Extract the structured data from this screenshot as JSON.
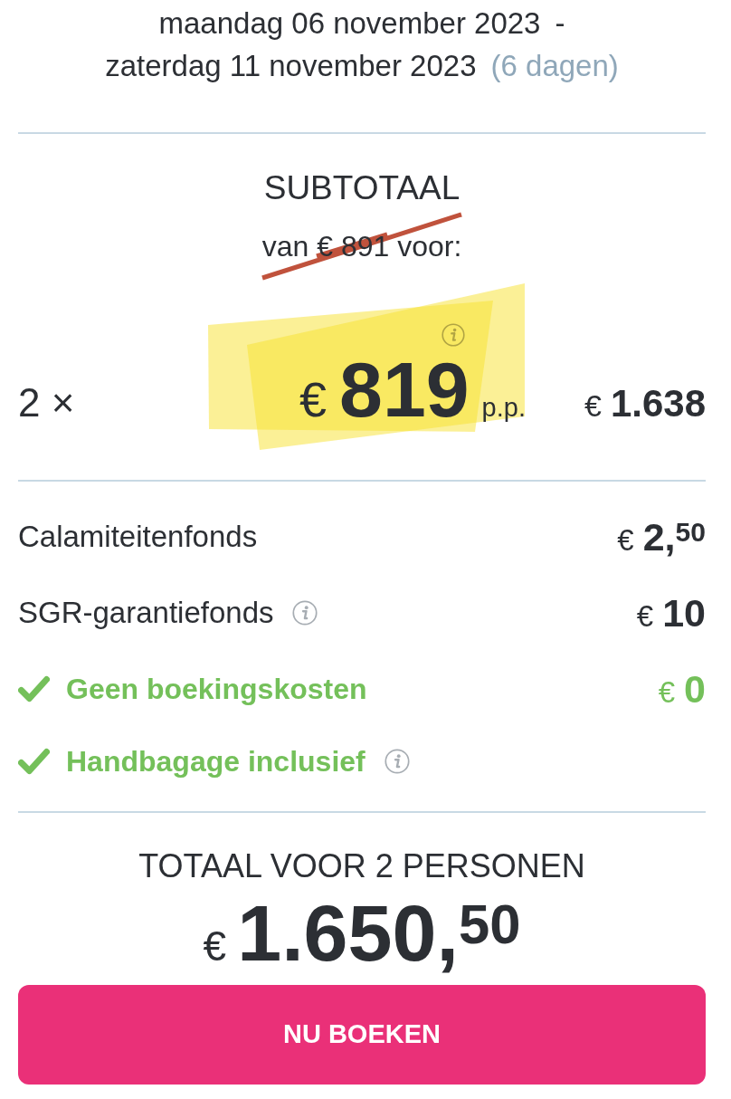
{
  "period": {
    "start_date": "maandag 06 november 2023",
    "separator": "-",
    "end_date": "zaterdag 11 november 2023",
    "duration": "(6 dagen)"
  },
  "subtotal": {
    "title": "SUBTOTAAL",
    "old_price": {
      "text": "van € 891 voor:",
      "struck": true
    },
    "quantity": "2 ×",
    "per_person": {
      "currency": "€",
      "amount": "819",
      "unit": "p.p.",
      "highlighted": true,
      "info": true
    },
    "line_total": {
      "currency": "€",
      "amount": "1.638"
    }
  },
  "fees": [
    {
      "kind": "fee",
      "label": "Calamiteitenfonds",
      "info": false,
      "currency": "€",
      "amount": "2,$^{50}$"
    },
    {
      "kind": "fee",
      "label": "SGR-garantiefonds",
      "info": true,
      "currency": "€",
      "amount": "10"
    },
    {
      "kind": "included",
      "label": "Geen boekingskosten",
      "info": false,
      "currency": "€",
      "amount": "0"
    },
    {
      "kind": "included",
      "label": "Handbagage inclusief",
      "info": true
    }
  ],
  "total": {
    "title": "TOTAAL VOOR 2 PERSONEN",
    "currency": "€",
    "amount": "1.650,$^{50}$"
  },
  "book_button": {
    "label": "NU BOEKEN"
  }
}
